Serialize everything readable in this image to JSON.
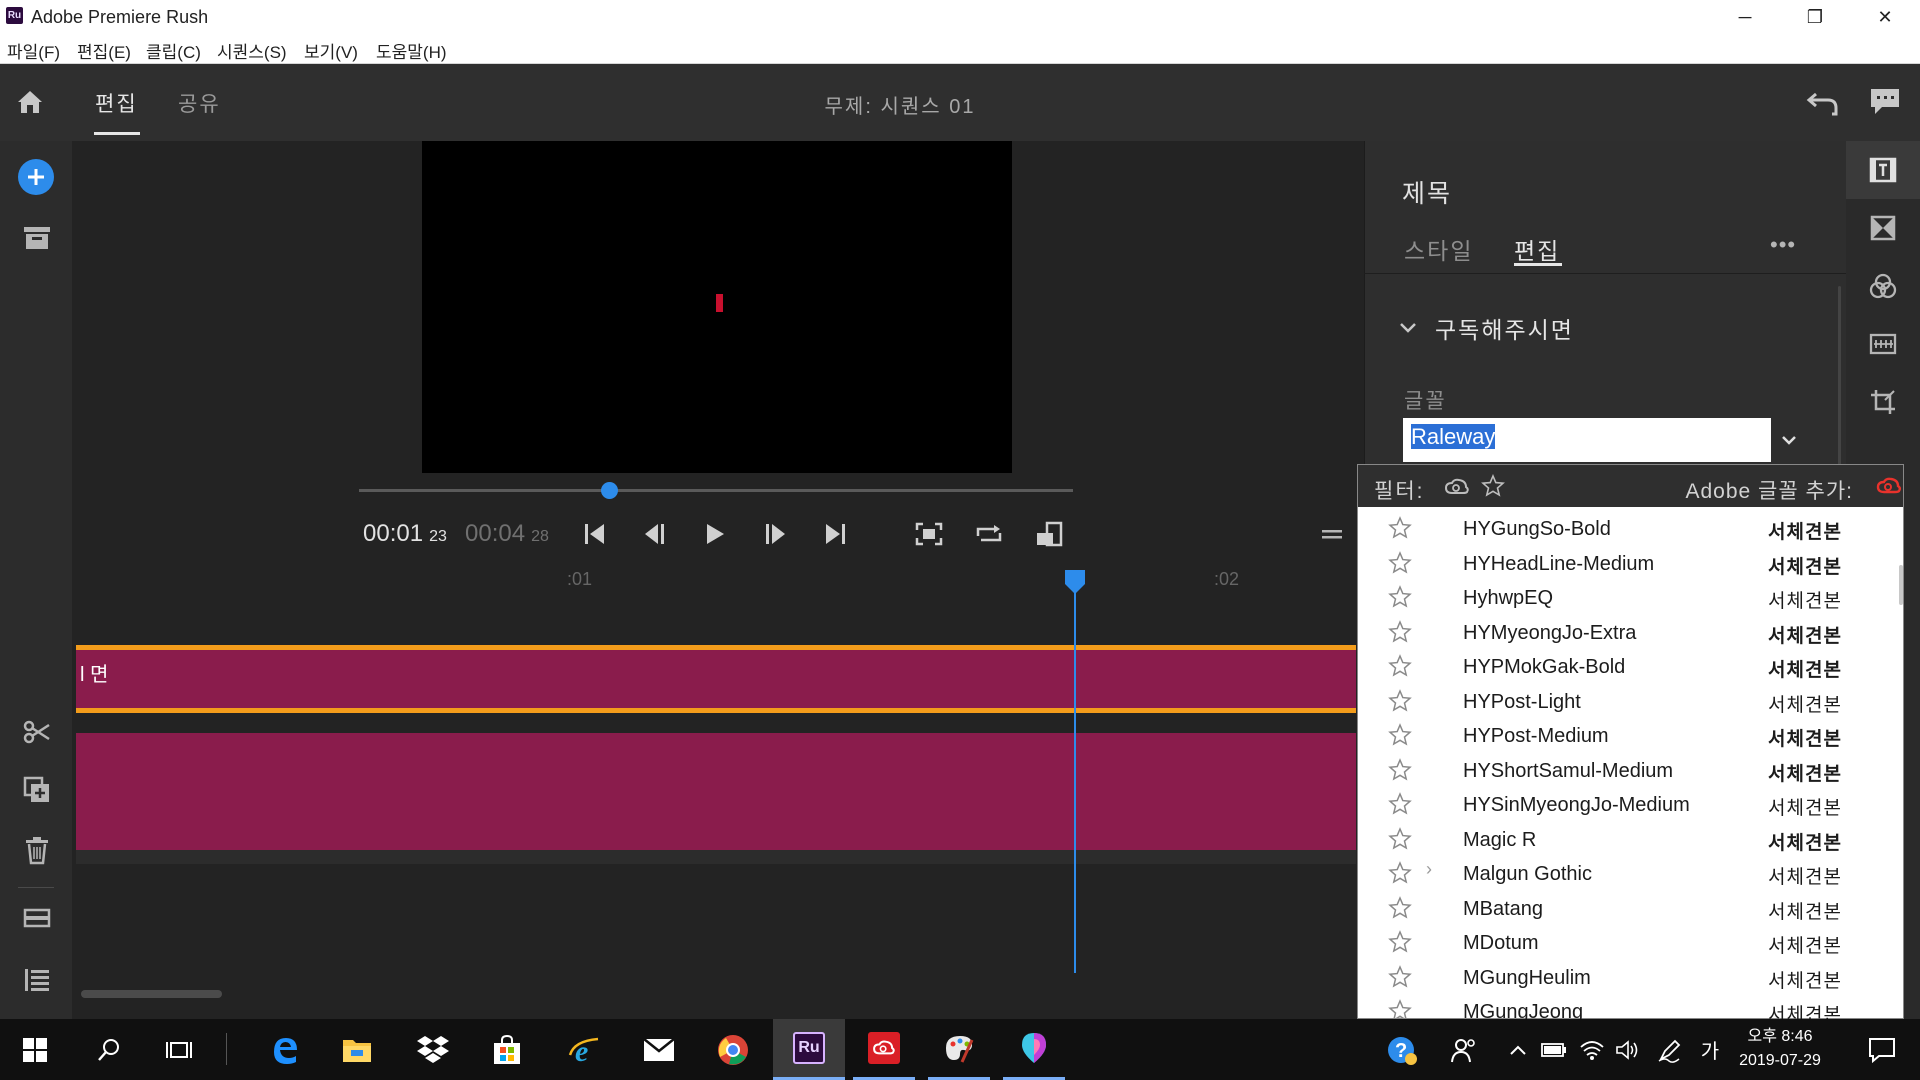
{
  "window": {
    "app_title": "Adobe Premiere Rush",
    "app_logo": "Ru",
    "minimize": "─",
    "restore": "❐",
    "close": "✕"
  },
  "menu": [
    "파일(F)",
    "편집(E)",
    "클립(C)",
    "시퀀스(S)",
    "보기(V)",
    "도움말(H)"
  ],
  "topbar": {
    "tabs": [
      "편집",
      "공유"
    ],
    "active_tab": "편집",
    "sequence_title": "무제: 시퀀스 01"
  },
  "player": {
    "current_time": "00:01",
    "current_frames": "23",
    "total_time": "00:04",
    "total_frames": "28",
    "progress": 0.35
  },
  "timeline": {
    "ruler_labels": [
      ":01",
      ":02"
    ],
    "clip_title_text": "l 면"
  },
  "right_panel": {
    "title": "제목",
    "tabs": [
      "스타일",
      "편집"
    ],
    "active_tab": "편집",
    "more": "•••",
    "section_heading": "구독해주시면",
    "font_label": "글꼴",
    "font_value": "Raleway"
  },
  "font_dropdown": {
    "filter_label": "필터:",
    "add_fonts_label": "Adobe 글꼴 추가:",
    "fonts": [
      {
        "name": "HYGungSo-Bold",
        "sample": "서체견본",
        "weight": "bold",
        "family": "serif"
      },
      {
        "name": "HYHeadLine-Medium",
        "sample": "서체견본",
        "weight": "bold",
        "family": "sans"
      },
      {
        "name": "HyhwpEQ",
        "sample": "서체견본",
        "weight": "normal",
        "family": "serif"
      },
      {
        "name": "HYMyeongJo-Extra",
        "sample": "서체견본",
        "weight": "bold",
        "family": "serif"
      },
      {
        "name": "HYPMokGak-Bold",
        "sample": "서체견본",
        "weight": "bold",
        "family": "sans"
      },
      {
        "name": "HYPost-Light",
        "sample": "서체견본",
        "weight": "normal",
        "family": "serif"
      },
      {
        "name": "HYPost-Medium",
        "sample": "서체견본",
        "weight": "bold",
        "family": "serif"
      },
      {
        "name": "HYShortSamul-Medium",
        "sample": "서체견본",
        "weight": "bold",
        "family": "sans"
      },
      {
        "name": "HYSinMyeongJo-Medium",
        "sample": "서체견본",
        "weight": "normal",
        "family": "serif"
      },
      {
        "name": "Magic R",
        "sample": "서체견본",
        "weight": "bold",
        "family": "sans"
      },
      {
        "name": "Malgun Gothic",
        "sample": "서체견본",
        "weight": "normal",
        "family": "sans",
        "expandable": true
      },
      {
        "name": "MBatang",
        "sample": "서체견본",
        "weight": "normal",
        "family": "serif"
      },
      {
        "name": "MDotum",
        "sample": "서체견본",
        "weight": "normal",
        "family": "sans"
      },
      {
        "name": "MGungHeulim",
        "sample": "서체견본",
        "weight": "normal",
        "family": "serif"
      },
      {
        "name": "MGungJeong",
        "sample": "서체견본",
        "weight": "normal",
        "family": "serif"
      }
    ]
  },
  "clock": {
    "time": "오후 8:46",
    "date": "2019-07-29"
  },
  "tray": {
    "ime": "가"
  },
  "colors": {
    "accent": "#2d8ceb",
    "clip": "#8a1c4c",
    "clip_border": "#f39c1b",
    "title_mark": "#c8102e"
  },
  "icons": [
    "home-icon",
    "undo-icon",
    "chat-icon",
    "add-media-icon",
    "media-bin-icon",
    "scissors-icon",
    "duplicate-icon",
    "trash-icon",
    "track-layout-icon",
    "track-list-icon",
    "titles-icon",
    "transitions-icon",
    "color-icon",
    "speed-icon",
    "crop-icon",
    "star-icon",
    "creative-cloud-icon"
  ]
}
